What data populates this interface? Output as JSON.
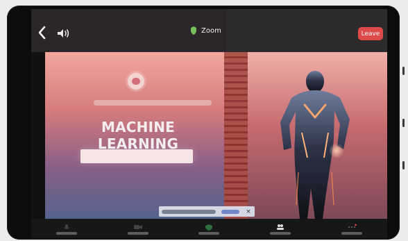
{
  "header": {
    "zoom_label": "Zoom",
    "leave_label": "Leave"
  },
  "slide": {
    "title": "MACHINE LEARNING"
  },
  "icons": {
    "back": "chevron-left-icon",
    "speaker": "speaker-icon",
    "shield": "shield-icon",
    "mute": "microphone-icon",
    "video": "video-icon",
    "security": "security-icon",
    "participants": "participants-icon",
    "more": "more-icon"
  },
  "colors": {
    "leave_button": "#de4a4a",
    "slide_top": "#f2a79b",
    "slide_bottom": "#54638e"
  }
}
